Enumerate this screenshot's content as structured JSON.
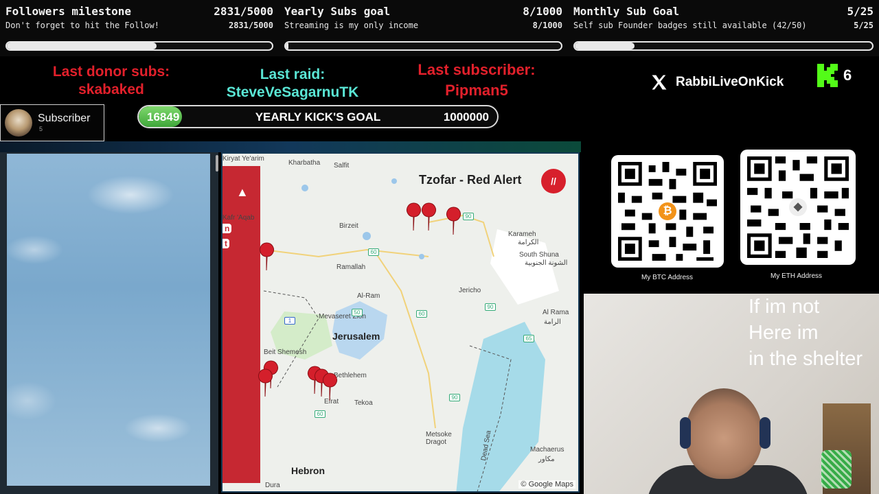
{
  "goals": [
    {
      "title": "Followers milestone",
      "count": "2831/5000",
      "subtitle": "Don't forget to hit the Follow!",
      "count2": "2831/5000",
      "progress": 0.566
    },
    {
      "title": "Yearly Subs goal",
      "count": "8/1000",
      "subtitle": "Streaming is my only income",
      "count2": "8/1000",
      "progress": 0.008
    },
    {
      "title": "Monthly Sub Goal",
      "count": "5/25",
      "subtitle": "Self sub Founder badges still available (42/50)",
      "count2": "5/25",
      "progress": 0.2
    }
  ],
  "info": {
    "donor_label": "Last donor subs:",
    "donor_name": "skabaked",
    "raid_label": "Last raid:",
    "raid_name": "SteveVeSagarnuTK",
    "subscriber_label": "Last subscriber:",
    "subscriber_name": "Pipman5"
  },
  "social": {
    "x_handle": "RabbiLiveOnKick",
    "kick_count": "6"
  },
  "subscriber_card": {
    "label": "Subscriber",
    "number": "5"
  },
  "kick_goal": {
    "current": "16849",
    "label": "YEARLY KICK'S GOAL",
    "target": "1000000"
  },
  "map": {
    "title": "Tzofar - Red Alert",
    "logo": "//",
    "panel_tags": [
      "n",
      "t"
    ],
    "places": [
      "Salfit",
      "Birzeit",
      "Ramallah",
      "Al-Ram",
      "Jericho",
      "Karameh",
      "South Shuna",
      "Al Rama",
      "Bethlehem",
      "Tekoa",
      "Metsoke Dragot",
      "Machaerus",
      "Dura",
      "Kiryat Ye'arim",
      "Mevaseret Zion",
      "Beit Shemesh",
      "Efrat",
      "Kharbatha",
      "Kafr 'Aqab"
    ],
    "arabic_places": [
      "الكرامة",
      "الشونة الجنوبية",
      "الرامة",
      "مكاور"
    ],
    "cities": [
      "Jerusalem",
      "Hebron"
    ],
    "route_numbers": [
      "60",
      "90",
      "1",
      "60",
      "90",
      "65",
      "60",
      "90",
      "50"
    ],
    "water_label": "Dead Sea",
    "credit": "© Google Maps"
  },
  "qr": {
    "btc_label": "My BTC Address",
    "eth_label": "My ETH Address",
    "btc_symbol": "₿",
    "eth_symbol": "◆"
  },
  "webcam": {
    "note": "If im not\nHere im\nin the shelter"
  }
}
